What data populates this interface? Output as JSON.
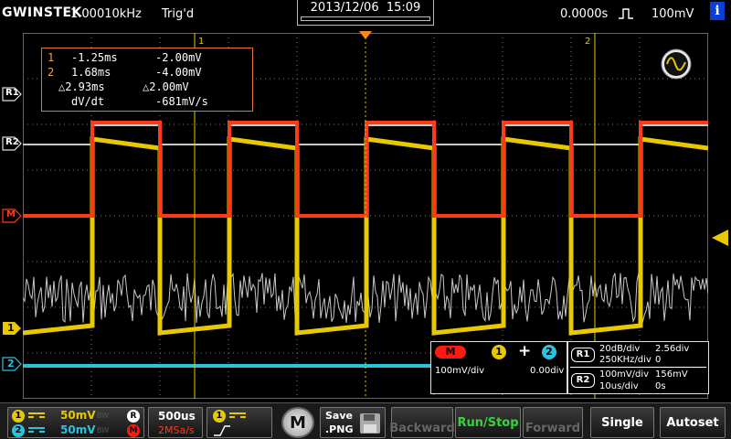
{
  "status": {
    "brand": "GWINSTEK",
    "frequency": "1.00010kHz",
    "trigger_state": "Trig'd",
    "date": "2013/12/06",
    "time": "15:09",
    "horizontal_position": "0.0000s",
    "trigger_level": "100mV",
    "info_icon": "i"
  },
  "markers": {
    "r1": "R1",
    "r2": "R2",
    "math": "M",
    "ch1": "1",
    "ch2": "2",
    "cursor1_top": "1",
    "cursor2_top": "2"
  },
  "cursor_readout": {
    "row1": {
      "num": "1",
      "time": "-1.25ms",
      "value": "-2.00mV"
    },
    "row2": {
      "num": "2",
      "time": "1.68ms",
      "value": "-4.00mV"
    },
    "row3": {
      "time": "△2.93ms",
      "value": "△2.00mV"
    },
    "row4": {
      "label": "dV/dt",
      "value": "-681mV/s"
    }
  },
  "math_info": {
    "badge": "M",
    "source1": "1",
    "operator": "+",
    "source2": "2",
    "scale": "100mV/div",
    "offset": "0.00div"
  },
  "ref_info": {
    "r1": {
      "label": "R1",
      "scale": "20dB/div",
      "pos": "2.56div",
      "timebase": "250KHz/div",
      "offset": "0"
    },
    "r2": {
      "label": "R2",
      "scale": "100mV/div",
      "pos": "156mV",
      "timebase": "10us/div",
      "offset": "0s"
    }
  },
  "bottom": {
    "ch1_scale": "50mV",
    "ch2_scale": "50mV",
    "ch1_num": "1",
    "ch2_num": "2",
    "bw_label": "BW",
    "r_badge": "R",
    "m_badge": "M",
    "timebase": "500us",
    "sample_rate": "2MSa/s",
    "trigger_source": "1",
    "menu_key": "M",
    "save_line1": "Save",
    "save_line2": ".PNG",
    "backward": "Backward",
    "run_stop": "Run/Stop",
    "forward": "Forward",
    "single": "Single",
    "autoset": "Autoset"
  },
  "colors": {
    "ch1": "#e8c800",
    "ch2": "#29c3e0",
    "math": "#ff3a1a",
    "ref1": "#c8c8c8",
    "accent_orange": "#e0743a",
    "run_green": "#36d43a"
  }
}
